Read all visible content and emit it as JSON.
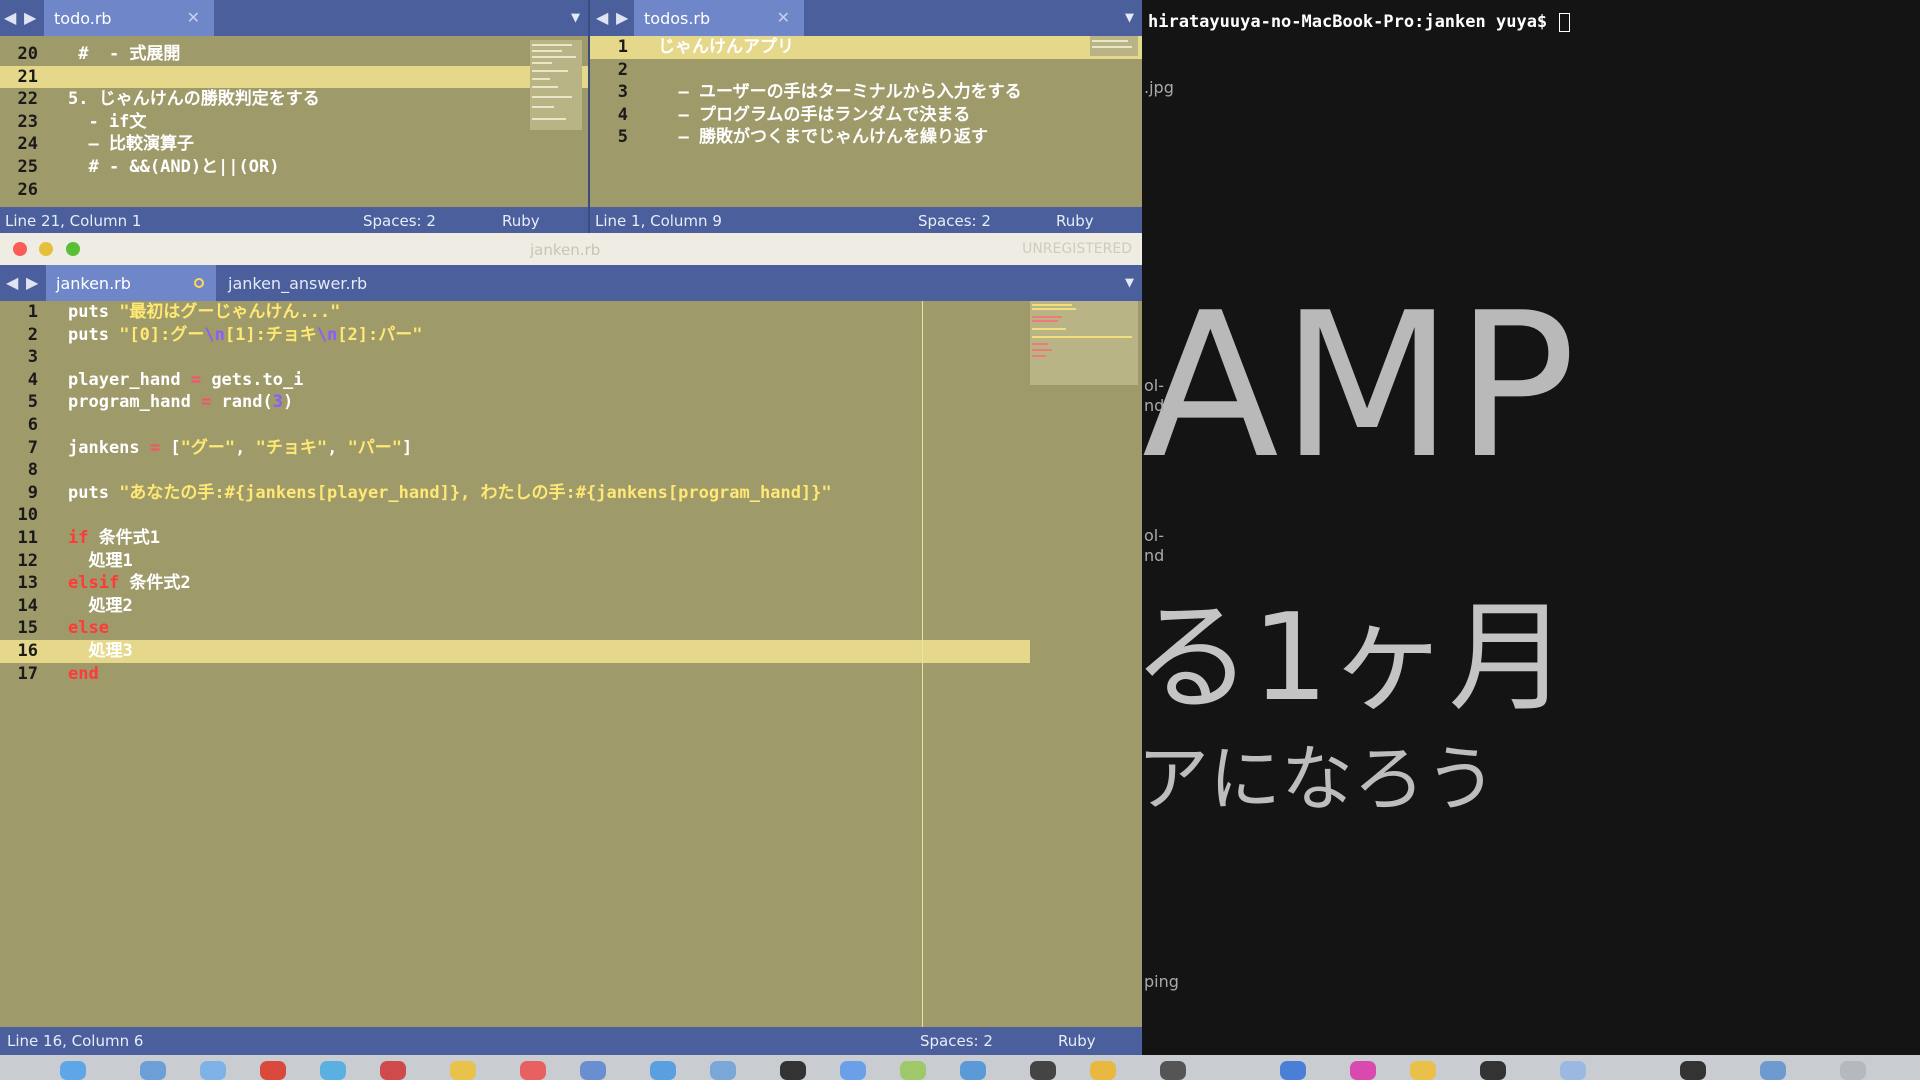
{
  "top_left": {
    "tab": {
      "label": "todo.rb"
    },
    "lines": [
      {
        "n": "20",
        "t": " #  - 式展開"
      },
      {
        "n": "21",
        "t": ""
      },
      {
        "n": "22",
        "t": "5. じゃんけんの勝敗判定をする"
      },
      {
        "n": "23",
        "t": "  - if文"
      },
      {
        "n": "24",
        "t": "  — 比較演算子"
      },
      {
        "n": "25",
        "t": "  # - &&(AND)と||(OR)"
      },
      {
        "n": "26",
        "t": ""
      }
    ],
    "status": {
      "position": "Line 21, Column 1",
      "spaces": "Spaces: 2",
      "syntax": "Ruby"
    }
  },
  "top_right": {
    "tab": {
      "label": "todos.rb"
    },
    "lines": [
      {
        "n": "1",
        "t": "じゃんけんアプリ"
      },
      {
        "n": "2",
        "t": ""
      },
      {
        "n": "3",
        "t": "  — ユーザーの手はターミナルから入力をする"
      },
      {
        "n": "4",
        "t": "  — プログラムの手はランダムで決まる"
      },
      {
        "n": "5",
        "t": "  — 勝敗がつくまでじゃんけんを繰り返す"
      }
    ],
    "status": {
      "position": "Line 1, Column 9",
      "spaces": "Spaces: 2",
      "syntax": "Ruby"
    }
  },
  "main": {
    "window_title": "janken.rb",
    "unregistered": "UNREGISTERED",
    "tabs": [
      {
        "label": "janken.rb"
      },
      {
        "label": "janken_answer.rb"
      }
    ],
    "lines": [
      {
        "n": "1",
        "parts": [
          [
            "plain",
            "puts "
          ],
          [
            "str",
            "\"最初はグーじゃんけん...\""
          ]
        ]
      },
      {
        "n": "2",
        "parts": [
          [
            "plain",
            "puts "
          ],
          [
            "str",
            "\"[0]:グー"
          ],
          [
            "esc",
            "\\n"
          ],
          [
            "str",
            "[1]:チョキ"
          ],
          [
            "esc",
            "\\n"
          ],
          [
            "str",
            "[2]:パー\""
          ]
        ]
      },
      {
        "n": "3",
        "parts": []
      },
      {
        "n": "4",
        "parts": [
          [
            "plain",
            "player_hand "
          ],
          [
            "op",
            "="
          ],
          [
            "plain",
            " gets.to_i"
          ]
        ]
      },
      {
        "n": "5",
        "parts": [
          [
            "plain",
            "program_hand "
          ],
          [
            "op",
            "="
          ],
          [
            "plain",
            " rand("
          ],
          [
            "num",
            "3"
          ],
          [
            "plain",
            ")"
          ]
        ]
      },
      {
        "n": "6",
        "parts": []
      },
      {
        "n": "7",
        "parts": [
          [
            "plain",
            "jankens "
          ],
          [
            "op",
            "="
          ],
          [
            "plain",
            " ["
          ],
          [
            "str",
            "\"グー\""
          ],
          [
            "plain",
            ", "
          ],
          [
            "str",
            "\"チョキ\""
          ],
          [
            "plain",
            ", "
          ],
          [
            "str",
            "\"パー\""
          ],
          [
            "plain",
            "]"
          ]
        ]
      },
      {
        "n": "8",
        "parts": []
      },
      {
        "n": "9",
        "parts": [
          [
            "plain",
            "puts "
          ],
          [
            "str",
            "\"あなたの手:#{jankens[player_hand]}, わたしの手:#{jankens[program_hand]}\""
          ]
        ]
      },
      {
        "n": "10",
        "parts": []
      },
      {
        "n": "11",
        "parts": [
          [
            "kw",
            "if"
          ],
          [
            "plain",
            " 条件式1"
          ]
        ]
      },
      {
        "n": "12",
        "parts": [
          [
            "plain",
            "  処理1"
          ]
        ]
      },
      {
        "n": "13",
        "parts": [
          [
            "kw",
            "elsif"
          ],
          [
            "plain",
            " 条件式2"
          ]
        ]
      },
      {
        "n": "14",
        "parts": [
          [
            "plain",
            "  処理2"
          ]
        ]
      },
      {
        "n": "15",
        "parts": [
          [
            "kw",
            "else"
          ]
        ]
      },
      {
        "n": "16",
        "parts": [
          [
            "plain",
            "  処理3"
          ]
        ]
      },
      {
        "n": "17",
        "parts": [
          [
            "kw",
            "end"
          ]
        ]
      }
    ],
    "highlight_line": "16",
    "status": {
      "position": "Line 16, Column 6",
      "spaces": "Spaces: 2",
      "syntax": "Ruby"
    }
  },
  "terminal": {
    "prompt": "hiratayuuya-no-MacBook-Pro:janken yuya$ ",
    "fragments": [
      ".jpg",
      "ol-",
      "nd",
      "ol-",
      "nd",
      "ping"
    ]
  },
  "background": {
    "big": "AMP",
    "line2": "る1ヶ月",
    "line3": "アになろう"
  },
  "colors": {
    "editor_bg": "#9e9a6a",
    "tabbar": "#4a5f9c",
    "string": "#ffe873",
    "keyword": "#ff3a3a",
    "highlight": "#e6d88a"
  }
}
